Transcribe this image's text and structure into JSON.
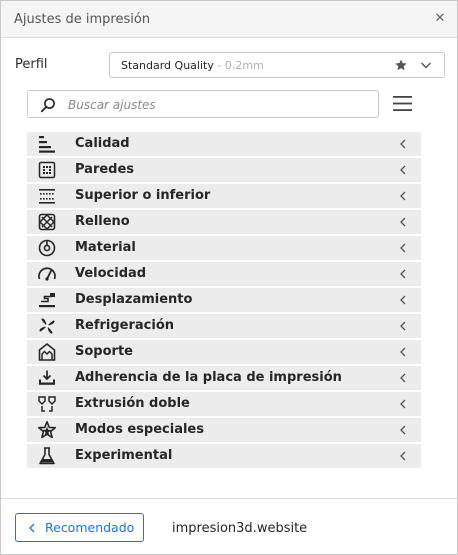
{
  "window": {
    "title": "Ajustes de impresión"
  },
  "profile": {
    "label": "Perfil",
    "name": "Standard Quality",
    "sub": " - 0.2mm"
  },
  "search": {
    "placeholder": "Buscar ajustes"
  },
  "categories": [
    {
      "label": "Calidad",
      "icon": "quality-icon"
    },
    {
      "label": "Paredes",
      "icon": "walls-icon"
    },
    {
      "label": "Superior o inferior",
      "icon": "top-bottom-icon"
    },
    {
      "label": "Relleno",
      "icon": "infill-icon"
    },
    {
      "label": "Material",
      "icon": "material-icon"
    },
    {
      "label": "Velocidad",
      "icon": "speed-icon"
    },
    {
      "label": "Desplazamiento",
      "icon": "travel-icon"
    },
    {
      "label": "Refrigeración",
      "icon": "cooling-icon"
    },
    {
      "label": "Soporte",
      "icon": "support-icon"
    },
    {
      "label": "Adherencia de la placa de impresión",
      "icon": "adhesion-icon"
    },
    {
      "label": "Extrusión doble",
      "icon": "dual-extrusion-icon"
    },
    {
      "label": "Modos especiales",
      "icon": "special-modes-icon"
    },
    {
      "label": "Experimental",
      "icon": "experimental-icon"
    }
  ],
  "footer": {
    "recommended_label": "Recomendado",
    "site": "impresion3d.website"
  },
  "colors": {
    "accent": "#2671d6",
    "category_bg": "#ececec",
    "icon": "#262626"
  }
}
